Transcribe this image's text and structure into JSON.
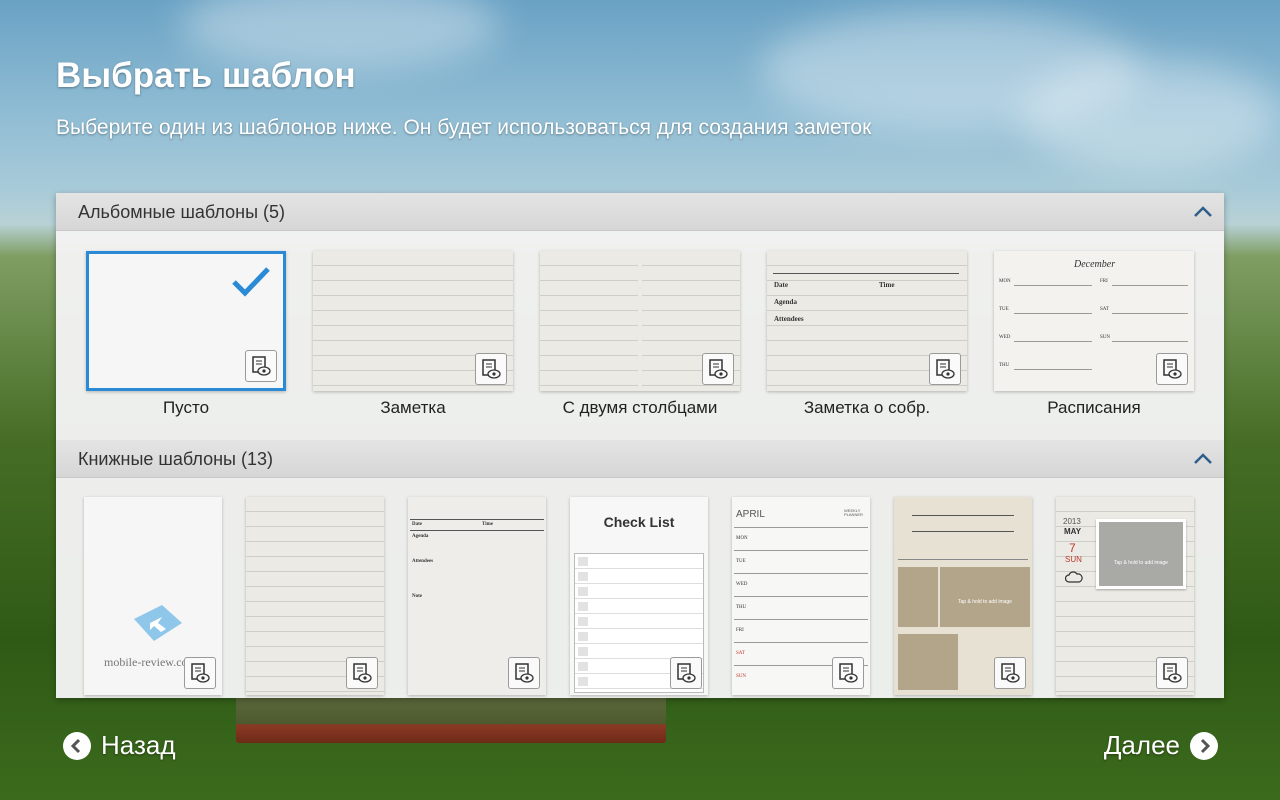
{
  "header": {
    "title": "Выбрать шаблон",
    "subtitle": "Выберите один из шаблонов ниже. Он будет использоваться для создания заметок"
  },
  "sections": {
    "landscape": {
      "title": "Альбомные шаблоны (5)",
      "items": [
        {
          "label": "Пусто",
          "selected": true
        },
        {
          "label": "Заметка"
        },
        {
          "label": "С двумя столбцами"
        },
        {
          "label": "Заметка о собр."
        },
        {
          "label": "Расписания"
        }
      ]
    },
    "book": {
      "title": "Книжные шаблоны (13)"
    }
  },
  "thumb_text": {
    "date": "Date",
    "time": "Time",
    "agenda": "Agenda",
    "attendees": "Attendees",
    "note": "Note",
    "december": "December",
    "mon": "MON",
    "tue": "TUE",
    "wed": "WED",
    "thu": "THU",
    "fri": "FRI",
    "sat": "SAT",
    "sun": "SUN",
    "check_list": "Check List",
    "april": "APRIL",
    "weekly_planner": "WEEKLY PLANNER",
    "tap_hold": "Tap & hold to add image",
    "year": "2013",
    "month": "MAY",
    "day": "7",
    "watermark": "mobile-review.com"
  },
  "nav": {
    "back": "Назад",
    "next": "Далее"
  },
  "colors": {
    "accent": "#2a8ad6",
    "chevron": "#2c5f8a",
    "red_day": "#c0392b"
  }
}
